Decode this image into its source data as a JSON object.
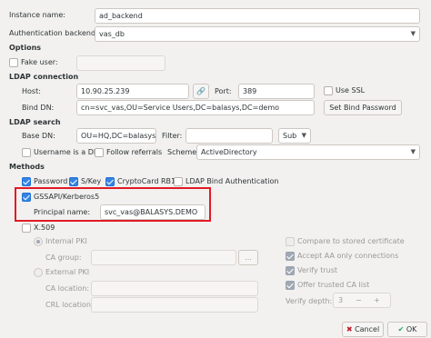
{
  "instance": {
    "label": "Instance name:",
    "value": "ad_backend"
  },
  "auth_backend": {
    "label": "Authentication backend:",
    "value": "vas_db"
  },
  "options": {
    "heading": "Options",
    "fake_user_label": "Fake user:"
  },
  "ldap_connection": {
    "heading": "LDAP connection",
    "host_label": "Host:",
    "host_value": "10.90.25.239",
    "port_label": "Port:",
    "port_value": "389",
    "use_ssl_label": "Use SSL",
    "bind_dn_label": "Bind DN:",
    "bind_dn_value": "cn=svc_vas,OU=Service Users,DC=balasys,DC=demo",
    "set_bind_password_label": "Set Bind Password"
  },
  "ldap_search": {
    "heading": "LDAP search",
    "base_dn_label": "Base DN:",
    "base_dn_value": "OU=HQ,DC=balasys,I",
    "filter_label": "Filter:",
    "filter_value": "",
    "scope_value": "Sub",
    "username_is_dn_label": "Username is a DN",
    "follow_referrals_label": "Follow referrals",
    "scheme_label": "Scheme:",
    "scheme_value": "ActiveDirectory"
  },
  "methods": {
    "heading": "Methods",
    "password_label": "Password",
    "skey_label": "S/Key",
    "cryptocard_label": "CryptoCard RB1",
    "ldap_bind_label": "LDAP Bind Authentication",
    "gssapi_label": "GSSAPI/Kerberos5",
    "principal_label": "Principal name:",
    "principal_value": "svc_vas@BALASYS.DEMO",
    "x509_label": "X.509",
    "internal_pki_label": "Internal PKI",
    "ca_group_label": "CA group:",
    "ellipsis_label": "...",
    "external_pki_label": "External PKI",
    "ca_location_label": "CA location:",
    "crl_location_label": "CRL location:",
    "compare_cert_label": "Compare to stored certificate",
    "accept_aa_label": "Accept AA only connections",
    "verify_trust_label": "Verify trust",
    "offer_ca_list_label": "Offer trusted CA list",
    "verify_depth_label": "Verify depth:",
    "verify_depth_value": "3",
    "minus_label": "−",
    "plus_label": "+"
  },
  "footer": {
    "cancel_label": "Cancel",
    "ok_label": "OK"
  },
  "colors": {
    "accent": "#3584e4",
    "highlight": "#e01b24"
  }
}
